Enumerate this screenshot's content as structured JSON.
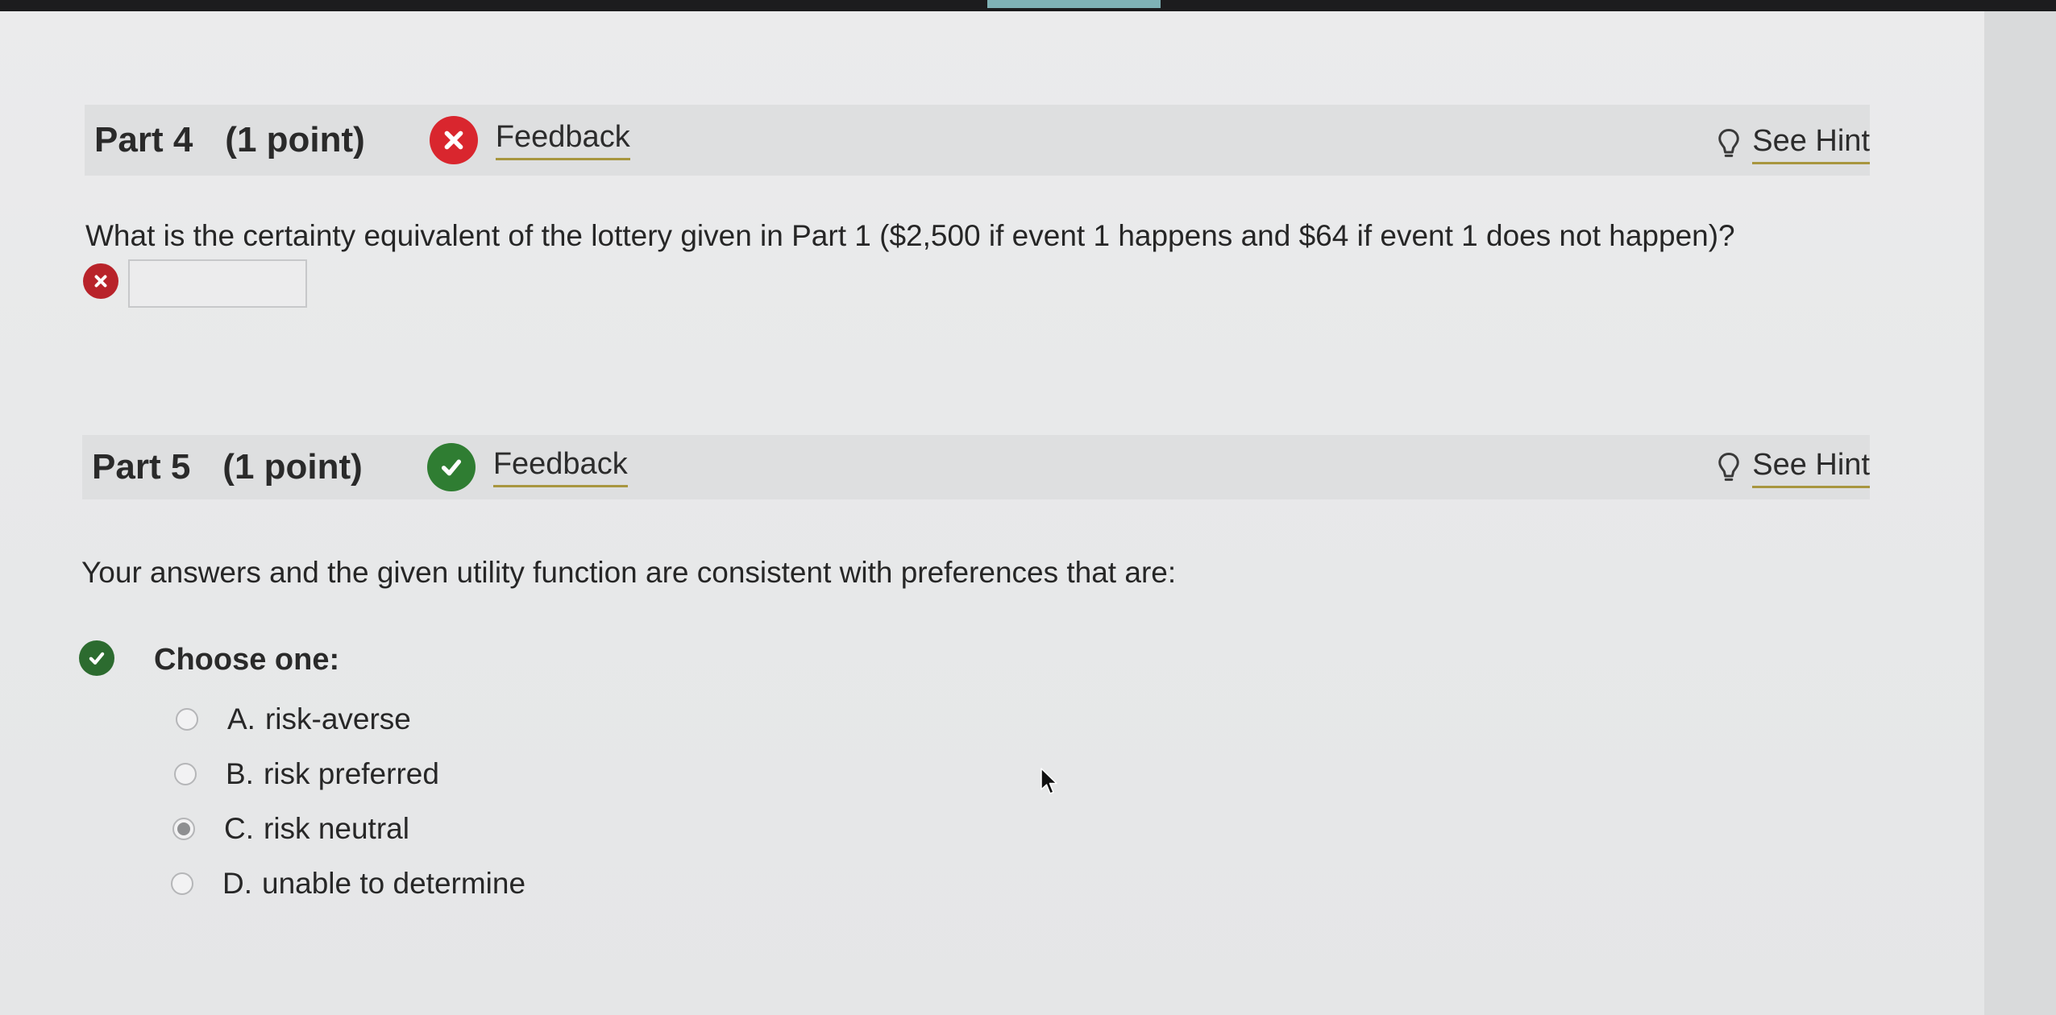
{
  "part4": {
    "title": "Part 4",
    "points": "(1 point)",
    "status": "incorrect",
    "feedback_label": "Feedback",
    "hint_label": "See Hint",
    "question": "What is the certainty equivalent of the lottery given in Part 1 ($2,500 if event 1 happens and $64 if event 1 does not happen)?",
    "answer_value": ""
  },
  "part5": {
    "title": "Part 5",
    "points": "(1 point)",
    "status": "correct",
    "feedback_label": "Feedback",
    "hint_label": "See Hint",
    "question": "Your answers and the given utility function are consistent with preferences that are:",
    "choose_label": "Choose one:",
    "options": [
      {
        "letter": "A.",
        "text": "risk-averse",
        "selected": false
      },
      {
        "letter": "B.",
        "text": "risk preferred",
        "selected": false
      },
      {
        "letter": "C.",
        "text": "risk neutral",
        "selected": true
      },
      {
        "letter": "D.",
        "text": "unable to determine",
        "selected": false
      }
    ]
  },
  "icons": {
    "incorrect": "x-circle-icon",
    "correct": "check-circle-icon",
    "hint": "lightbulb-icon",
    "pointer": "mouse-cursor-icon"
  },
  "colors": {
    "incorrect_red": "#d9262e",
    "correct_green": "#2f7d32",
    "link_underline": "#a8963f",
    "header_band": "#dedfe0"
  }
}
